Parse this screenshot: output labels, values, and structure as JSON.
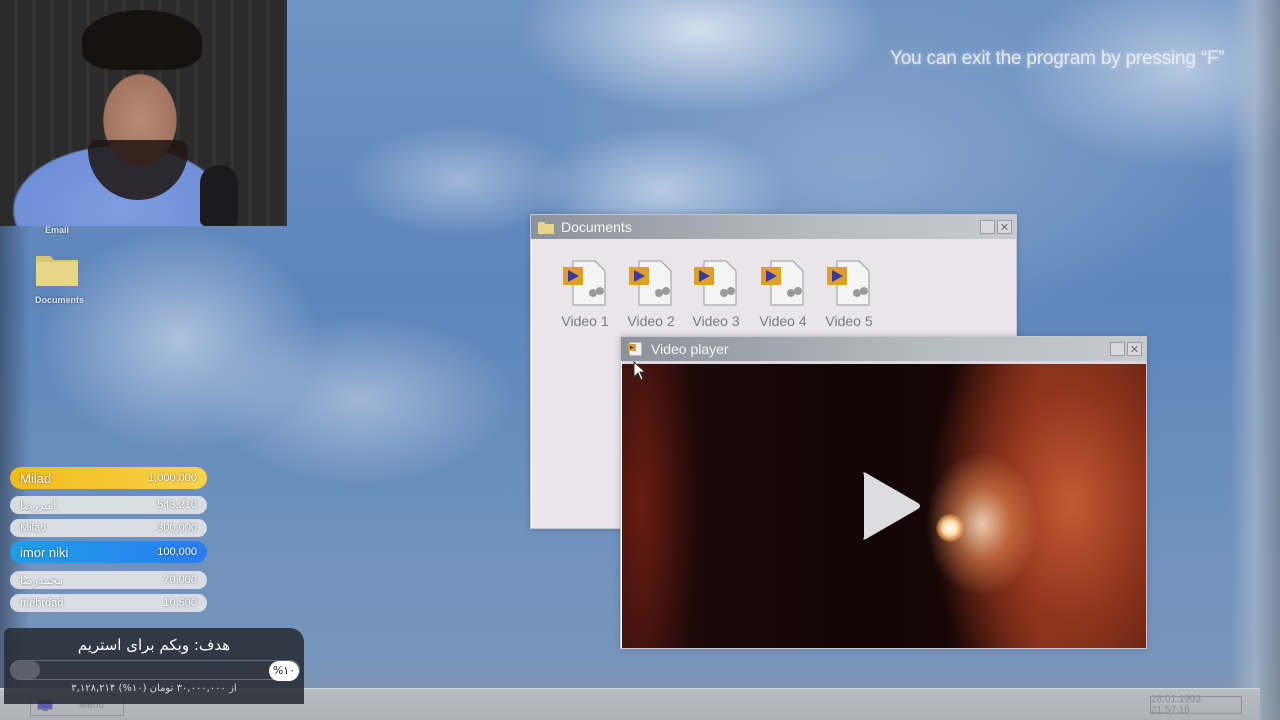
{
  "desktop": {
    "exit_hint": "You can exit the program by pressing “F”",
    "icons": [
      {
        "label": "Email"
      },
      {
        "label": "Documents"
      }
    ]
  },
  "documents_window": {
    "title": "Documents",
    "files": [
      {
        "label": "Video 1"
      },
      {
        "label": "Video 2"
      },
      {
        "label": "Video 3"
      },
      {
        "label": "Video 4"
      },
      {
        "label": "Video 5"
      }
    ]
  },
  "video_player": {
    "title": "Video player"
  },
  "leaderboard": [
    {
      "name": "Milad",
      "amount": "1,000,000",
      "style": "gold"
    },
    {
      "name": "امیررضا",
      "amount": "543,210",
      "style": "plain"
    },
    {
      "name": "Milad",
      "amount": "300,000",
      "style": "plain"
    },
    {
      "name": "imor niki",
      "amount": "100,000",
      "style": "blue"
    },
    {
      "name": "محمدرضا",
      "amount": "70,000",
      "style": "plain"
    },
    {
      "name": "mehrdad",
      "amount": "10,500",
      "style": "plain"
    }
  ],
  "goal": {
    "title": "هدف: وبکم برای استریم",
    "percent_label": "%۱۰",
    "progress": 0.1,
    "summary": "۳,۱۲۸,۲۱۴ از ۳۰,۰۰۰,۰۰۰ تومان (۱۰%)"
  },
  "taskbar": {
    "menu_label": "Menu",
    "clock": "28.01.1993 21:57:18"
  },
  "colors": {
    "gold": "#f2b91a",
    "blue": "#1d9fe6",
    "titlebar": "#8c929a"
  }
}
